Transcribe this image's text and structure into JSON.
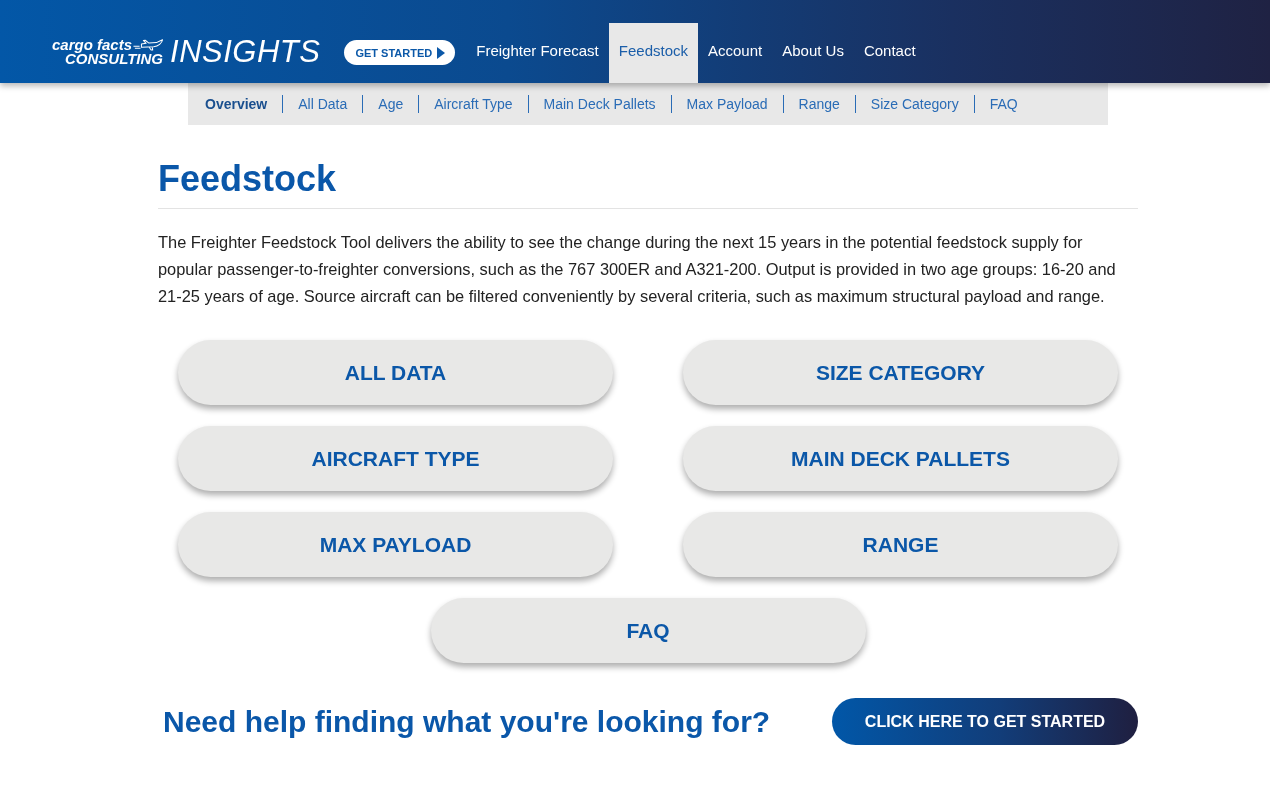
{
  "header": {
    "logo": {
      "line_1": "cargo facts",
      "line_2": "CONSULTING",
      "wordmark": "INSIGHTS"
    },
    "get_started_button": "GET STARTED",
    "nav": [
      {
        "label": "Freighter Forecast",
        "selected": false
      },
      {
        "label": "Feedstock",
        "selected": true
      },
      {
        "label": "Account",
        "selected": false
      },
      {
        "label": "About Us",
        "selected": false
      },
      {
        "label": "Contact",
        "selected": false
      }
    ]
  },
  "subnav": [
    {
      "label": "Overview",
      "selected": true
    },
    {
      "label": "All Data",
      "selected": false
    },
    {
      "label": "Age",
      "selected": false
    },
    {
      "label": "Aircraft Type",
      "selected": false
    },
    {
      "label": "Main Deck Pallets",
      "selected": false
    },
    {
      "label": "Max Payload",
      "selected": false
    },
    {
      "label": "Range",
      "selected": false
    },
    {
      "label": "Size Category",
      "selected": false
    },
    {
      "label": "FAQ",
      "selected": false
    }
  ],
  "page": {
    "title": "Feedstock",
    "intro": "The Freighter Feedstock Tool delivers the ability to see the change during the next 15 years in the potential feedstock supply for popular passenger-to-freighter conversions, such as the 767 300ER and A321-200. Output is provided in two age groups: 16-20 and 21-25 years of age. Source aircraft can be filtered conveniently by several criteria, such as maximum structural payload and range."
  },
  "category_buttons": [
    "ALL DATA",
    "SIZE CATEGORY",
    "AIRCRAFT TYPE",
    "MAIN DECK PALLETS",
    "MAX PAYLOAD",
    "RANGE",
    "FAQ"
  ],
  "help": {
    "question": "Need help finding what you're looking for?",
    "button": "CLICK HERE TO GET STARTED"
  }
}
